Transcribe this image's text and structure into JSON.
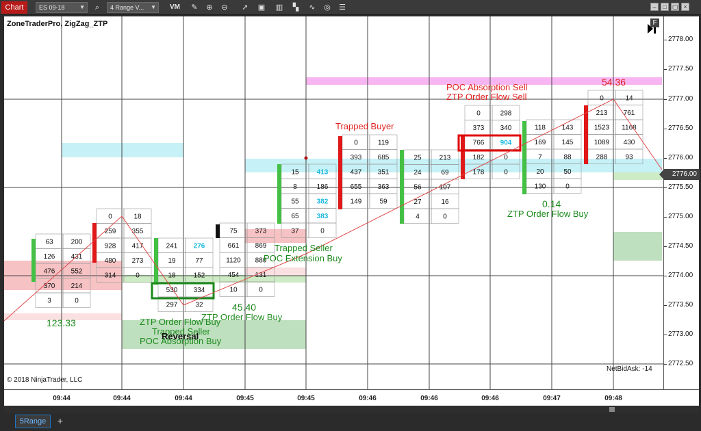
{
  "toolbar": {
    "chart_tab": "Chart",
    "instrument": "ES 09-18",
    "interval": "4 Range V...",
    "vm_label": "VM",
    "icons": [
      "pencil-icon",
      "zoom-in-icon",
      "zoom-out-icon",
      "pointer-icon",
      "data-box-icon",
      "bar-chart-icon",
      "strategies-icon",
      "indicators-icon",
      "refresh-icon",
      "properties-icon"
    ],
    "window_buttons": [
      "minimize",
      "maximize",
      "close"
    ]
  },
  "chart": {
    "indicator_label": "ZoneTraderPro, ZigZag_ZTP",
    "copyright": "© 2018 NinjaTrader, LLC",
    "netbidask": "NetBidAsk: -14",
    "f_badge": "F",
    "current_price": "2776.00",
    "y_ticks": [
      "2778.00",
      "2777.50",
      "2777.00",
      "2776.50",
      "2776.00",
      "2775.50",
      "2775.00",
      "2774.50",
      "2774.00",
      "2773.50",
      "2773.00",
      "2772.50"
    ],
    "x_ticks": [
      "09:44",
      "09:44",
      "09:44",
      "09:45",
      "09:45",
      "09:46",
      "09:46",
      "09:46",
      "09:47",
      "09:48"
    ]
  },
  "annotations": {
    "a_123": "123.33",
    "ztp_flow_buy_1": "ZTP Order Flow Buy",
    "trapped_seller_1": "Trapped Seller",
    "reversal": "Reversal",
    "poc_absorption_buy": "POC Absorption Buy",
    "a_4540": "45.40",
    "ztp_flow_buy_2": "ZTP Order Flow Buy",
    "trapped_seller_2": "Trapped Seller",
    "poc_extension_buy": "POC Extension Buy",
    "trapped_buyer": "Trapped Buyer",
    "poc_absorption_sell": "POC Absorption Sell",
    "ztp_flow_sell": "ZTP Order Flow Sell",
    "a_5436": "54.36",
    "a_014": "0.14",
    "ztp_flow_buy_3": "ZTP Order Flow Buy"
  },
  "bars": [
    {
      "rows": [
        [
          "63",
          "200"
        ],
        [
          "126",
          "431"
        ],
        [
          "476",
          "552"
        ],
        [
          "370",
          "214"
        ],
        [
          "3",
          "0"
        ]
      ]
    },
    {
      "rows": [
        [
          "0",
          "18"
        ],
        [
          "259",
          "355"
        ],
        [
          "928",
          "417"
        ],
        [
          "480",
          "273"
        ],
        [
          "314",
          "0"
        ]
      ]
    },
    {
      "rows": [
        [
          "241",
          "276"
        ],
        [
          "19",
          "77"
        ],
        [
          "18",
          "152"
        ],
        [
          "530",
          "334"
        ],
        [
          "297",
          "32"
        ]
      ]
    },
    {
      "rows": [
        [
          "75",
          "373"
        ],
        [
          "661",
          "869"
        ],
        [
          "1120",
          "880"
        ],
        [
          "454",
          "131"
        ],
        [
          "10",
          "0"
        ]
      ]
    },
    {
      "rows": [
        [
          "15",
          "413"
        ],
        [
          "8",
          "186"
        ],
        [
          "55",
          "382"
        ],
        [
          "65",
          "383"
        ],
        [
          "37",
          "0"
        ]
      ]
    },
    {
      "rows": [
        [
          "0",
          "119"
        ],
        [
          "393",
          "685"
        ],
        [
          "437",
          "351"
        ],
        [
          "655",
          "363"
        ],
        [
          "149",
          "59"
        ]
      ]
    },
    {
      "rows": [
        [
          "25",
          "213"
        ],
        [
          "24",
          "69"
        ],
        [
          "56",
          "107"
        ],
        [
          "27",
          "16"
        ],
        [
          "4",
          "0"
        ]
      ]
    },
    {
      "rows": [
        [
          "0",
          "298"
        ],
        [
          "373",
          "340"
        ],
        [
          "766",
          "904"
        ],
        [
          "182",
          "0"
        ],
        [
          "178",
          "0"
        ]
      ]
    },
    {
      "rows": [
        [
          "118",
          "143"
        ],
        [
          "169",
          "145"
        ],
        [
          "7",
          "88"
        ],
        [
          "20",
          "50"
        ],
        [
          "130",
          "0"
        ]
      ]
    },
    {
      "rows": [
        [
          "0",
          "14"
        ],
        [
          "213",
          "761"
        ],
        [
          "1523",
          "1168"
        ],
        [
          "1089",
          "430"
        ],
        [
          "288",
          "93"
        ]
      ]
    }
  ],
  "bottom": {
    "tab_label": "5Range",
    "add_label": "+"
  }
}
